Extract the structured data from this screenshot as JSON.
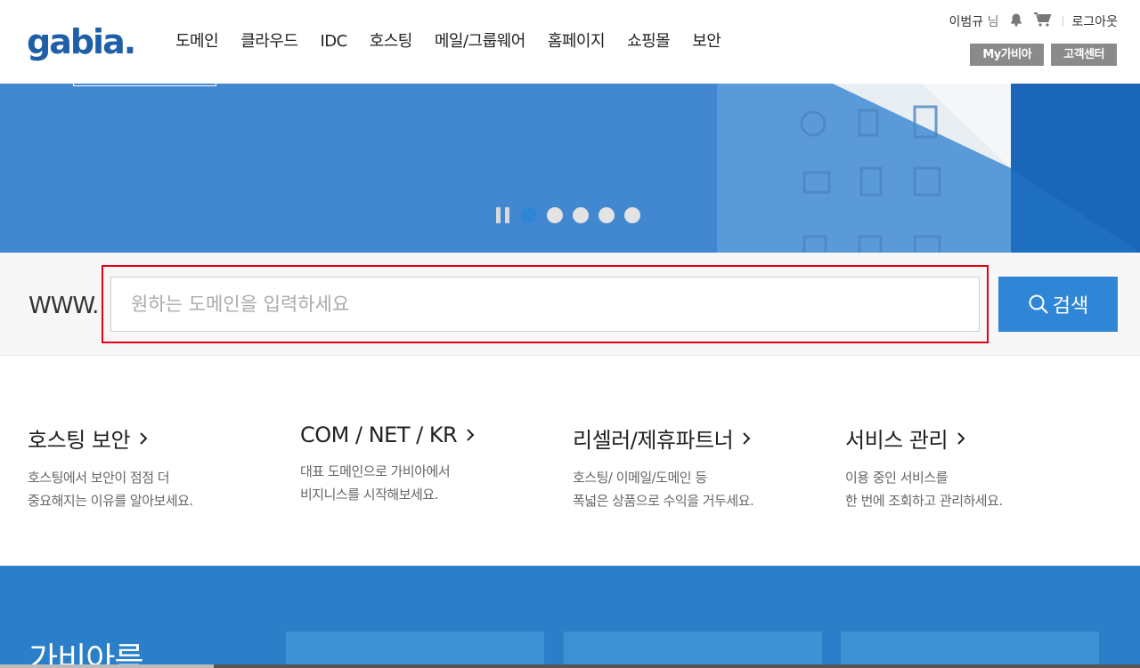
{
  "header": {
    "logo_text": "gabia.",
    "nav": [
      "도메인",
      "클라우드",
      "IDC",
      "호스팅",
      "메일/그룹웨어",
      "홈페이지",
      "쇼핑몰",
      "보안"
    ],
    "user_name": "이범규",
    "user_suffix": " 님",
    "logout": "로그아웃",
    "my_gabia": "My가비아",
    "support": "고객센터"
  },
  "banner": {
    "color": "#4188d1",
    "slides_total": 5,
    "active_slide": 1
  },
  "search": {
    "prefix": "WWW.",
    "placeholder": "원하는 도메인을 입력하세요",
    "value": "",
    "button_label": "검색"
  },
  "promos": [
    {
      "title": "호스팅 보안",
      "desc1": "호스팅에서 보안이 점점 더",
      "desc2": "중요해지는 이유를 알아보세요."
    },
    {
      "title": "COM / NET / KR",
      "desc1": "대표 도메인으로 가비아에서",
      "desc2": "비지니스를 시작해보세요."
    },
    {
      "title": "리셀러/제휴파트너",
      "desc1": "호스팅/ 이메일/도메인 등",
      "desc2": "폭넓은 상품으로 수익을 거두세요."
    },
    {
      "title": "서비스 관리",
      "desc1": "이용 중인 서비스를",
      "desc2": "한 번에 조회하고 관리하세요."
    }
  ],
  "bottom": {
    "title": "가비아륵"
  },
  "colors": {
    "accent": "#2f86d6",
    "highlight": "#e60012",
    "util_button": "#8a8a8a"
  }
}
